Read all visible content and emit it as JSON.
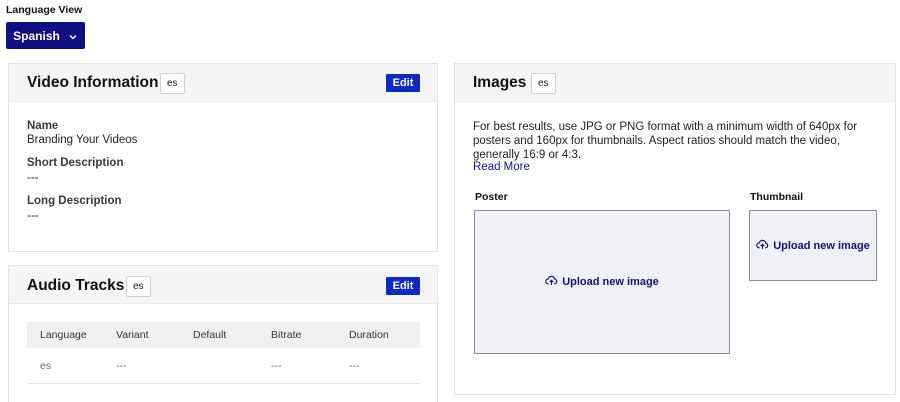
{
  "language_view": {
    "label": "Language View",
    "selected": "Spanish"
  },
  "video_information": {
    "title": "Video Information",
    "badge": "es",
    "edit_label": "Edit",
    "fields": [
      {
        "label": "Name",
        "value": "Branding Your Videos"
      },
      {
        "label": "Short Description",
        "value": "---"
      },
      {
        "label": "Long Description",
        "value": "---"
      }
    ]
  },
  "audio_tracks": {
    "title": "Audio Tracks",
    "badge": "es",
    "edit_label": "Edit",
    "columns": [
      "Language",
      "Variant",
      "Default",
      "Bitrate",
      "Duration"
    ],
    "rows": [
      [
        "es",
        "---",
        "",
        "---",
        "---"
      ]
    ]
  },
  "images": {
    "title": "Images",
    "badge": "es",
    "description": "For best results, use JPG or PNG format with a minimum width of 640px for posters and 160px for thumbnails. Aspect ratios should match the video, generally 16:9 or 4:3.",
    "read_more": "Read More",
    "poster": {
      "label": "Poster",
      "upload": "Upload new image"
    },
    "thumbnail": {
      "label": "Thumbnail",
      "upload": "Upload new image"
    }
  },
  "icons": {
    "language_chevron": "chevron-down-icon",
    "upload": "cloud-upload-icon"
  },
  "colors": {
    "primary_navy": "#0f0f83",
    "edit_blue": "#0c2ac4",
    "link": "#14148a"
  }
}
